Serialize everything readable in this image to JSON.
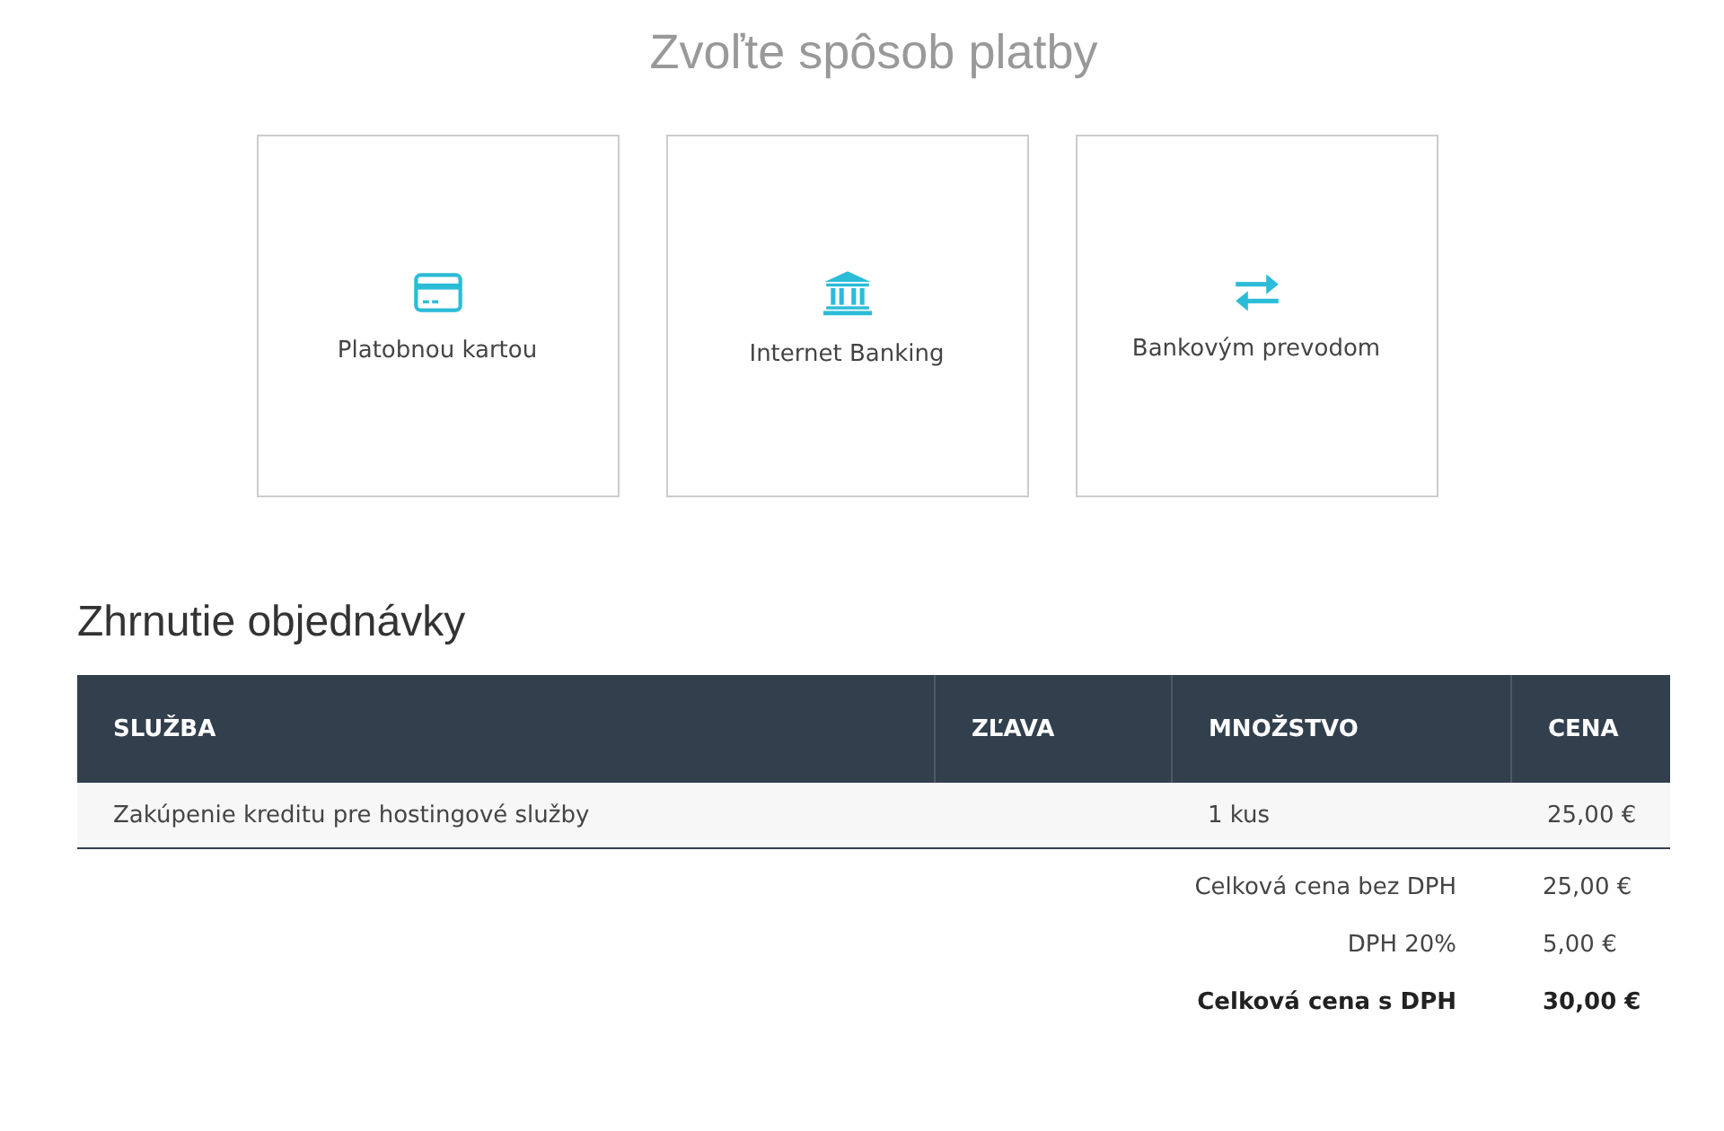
{
  "title": "Zvoľte spôsob platby",
  "methods": [
    {
      "kind": "card",
      "label": "Platobnou kartou"
    },
    {
      "kind": "bank",
      "label": "Internet Banking"
    },
    {
      "kind": "transfer",
      "label": "Bankovým prevodom"
    }
  ],
  "summary": {
    "heading": "Zhrnutie objednávky",
    "columns": [
      "SLUŽBA",
      "ZĽAVA",
      "MNOŽSTVO",
      "CENA"
    ],
    "rows": [
      [
        "Zakúpenie kreditu pre hostingové služby",
        "",
        "1 kus",
        "25,00 €"
      ]
    ],
    "totals": [
      {
        "label": "Celková cena bez DPH",
        "value": "25,00 €",
        "bold": false
      },
      {
        "label": "DPH 20%",
        "value": "5,00 €",
        "bold": false
      },
      {
        "label": "Celková cena s DPH",
        "value": "30,00 €",
        "bold": true
      }
    ]
  }
}
